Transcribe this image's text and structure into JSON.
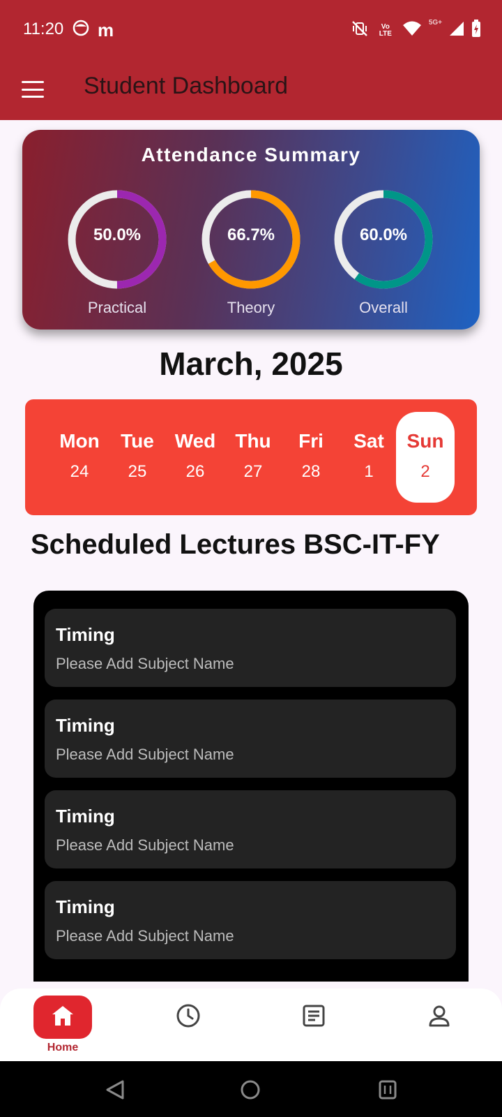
{
  "status_bar": {
    "time": "11:20",
    "left_icons": [
      "face-icon",
      "m-app-icon"
    ],
    "m_glyph": "m",
    "volte_label": "Vo LTE",
    "network_label": "5G+",
    "right_icons": [
      "vibrate-mute-icon",
      "volte-icon",
      "wifi-icon",
      "signal-icon",
      "battery-icon"
    ]
  },
  "app_bar": {
    "title": "Student Dashboard",
    "background": "#b22630"
  },
  "attendance": {
    "title": "Attendance Summary",
    "rings": [
      {
        "label": "Practical",
        "value_text": "50.0%",
        "fraction": 0.5,
        "color": "#9c27b0"
      },
      {
        "label": "Theory",
        "value_text": "66.7%",
        "fraction": 0.667,
        "color": "#ff9800"
      },
      {
        "label": "Overall",
        "value_text": "60.0%",
        "fraction": 0.6,
        "color": "#009688"
      }
    ]
  },
  "calendar": {
    "month_label": "March, 2025",
    "days": [
      {
        "name": "Mon",
        "date": "24",
        "selected": false
      },
      {
        "name": "Tue",
        "date": "25",
        "selected": false
      },
      {
        "name": "Wed",
        "date": "26",
        "selected": false
      },
      {
        "name": "Thu",
        "date": "27",
        "selected": false
      },
      {
        "name": "Fri",
        "date": "28",
        "selected": false
      },
      {
        "name": "Sat",
        "date": "1",
        "selected": false
      },
      {
        "name": "Sun",
        "date": "2",
        "selected": true
      }
    ],
    "strip_color": "#f44336"
  },
  "lectures": {
    "title": "Scheduled Lectures BSC-IT-FY",
    "items": [
      {
        "timing": "Timing",
        "subject": "Please Add Subject Name"
      },
      {
        "timing": "Timing",
        "subject": "Please Add Subject Name"
      },
      {
        "timing": "Timing",
        "subject": "Please Add Subject Name"
      },
      {
        "timing": "Timing",
        "subject": "Please Add Subject Name"
      }
    ]
  },
  "bottom_nav": {
    "items": [
      {
        "label": "Home",
        "icon": "home-icon",
        "active": true
      },
      {
        "label": "",
        "icon": "clock-icon",
        "active": false
      },
      {
        "label": "",
        "icon": "notes-icon",
        "active": false
      },
      {
        "label": "",
        "icon": "profile-icon",
        "active": false
      }
    ],
    "active_color": "#e0262e"
  },
  "system_nav": {
    "icons": [
      "back-icon",
      "home-circle-icon",
      "recents-icon"
    ]
  }
}
